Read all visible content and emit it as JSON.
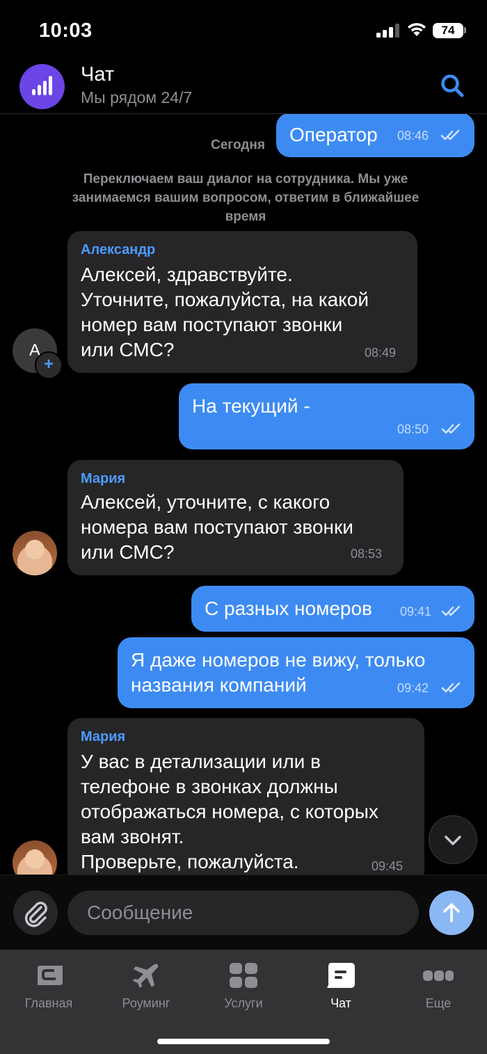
{
  "status_bar": {
    "time": "10:03",
    "battery": "74"
  },
  "header": {
    "title": "Чат",
    "subtitle": "Мы рядом 24/7"
  },
  "chat": {
    "date_label": "Сегодня",
    "system_message": "Переключаем ваш диалог на сотрудника. Мы уже занимаемся вашим вопросом, ответим в ближайшее время",
    "messages": [
      {
        "direction": "out",
        "lines": [
          "Оператор"
        ],
        "time": "08:46"
      },
      {
        "direction": "in",
        "sender": "Александр",
        "avatar_letter": "А",
        "lines": [
          "Алексей, здравствуйте.",
          "Уточните, пожалуйста, на какой",
          "номер вам поступают звонки",
          "или СМС?"
        ],
        "time": "08:49"
      },
      {
        "direction": "out",
        "lines": [
          "На текущий -"
        ],
        "time": "08:50"
      },
      {
        "direction": "in",
        "sender": "Мария",
        "lines": [
          "Алексей, уточните, с какого",
          "номера вам поступают звонки",
          "или СМС?"
        ],
        "time": "08:53"
      },
      {
        "direction": "out",
        "lines": [
          "С разных номеров"
        ],
        "time": "09:41"
      },
      {
        "direction": "out",
        "lines": [
          "Я даже номеров не вижу, только",
          "названия компаний"
        ],
        "time": "09:42"
      },
      {
        "direction": "in",
        "sender": "Мария",
        "lines": [
          "У вас в детализации или в",
          "телефоне в звонках должны",
          "отображаться номера, с которых",
          "вам звонят.",
          "Проверьте, пожалуйста."
        ],
        "time": "09:45"
      }
    ]
  },
  "composer": {
    "placeholder": "Сообщение"
  },
  "tabs": [
    {
      "label": "Главная",
      "icon": "home-card-icon",
      "active": false
    },
    {
      "label": "Роуминг",
      "icon": "airplane-icon",
      "active": false
    },
    {
      "label": "Услуги",
      "icon": "grid-icon",
      "active": false
    },
    {
      "label": "Чат",
      "icon": "chat-bubble-icon",
      "active": true
    },
    {
      "label": "Еще",
      "icon": "more-dots-icon",
      "active": false
    }
  ],
  "colors": {
    "accent": "#3d8bf2",
    "incoming_bubble": "#262628",
    "brand": "#6b45e6"
  }
}
